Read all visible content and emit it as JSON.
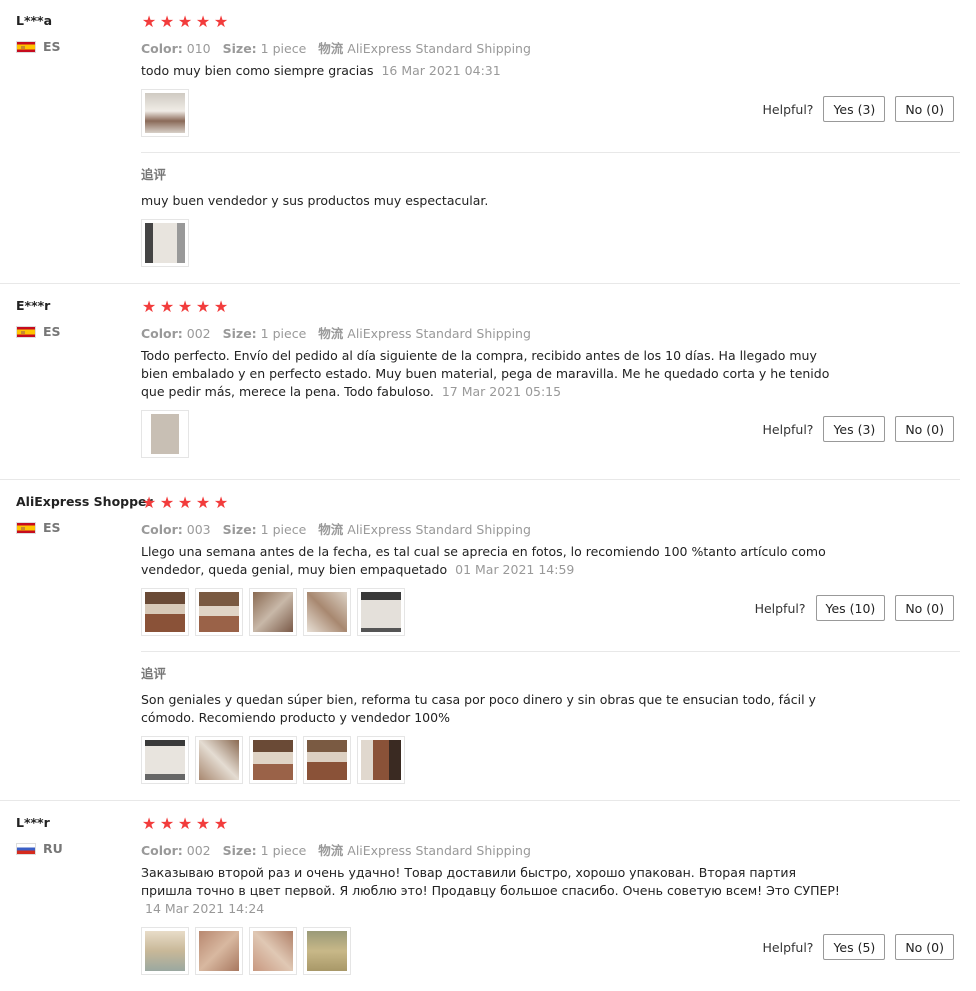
{
  "labels": {
    "color": "Color:",
    "size": "Size:",
    "shipping_key": "物流",
    "helpful": "Helpful?",
    "follow_up": "追评"
  },
  "reviews": [
    {
      "user": "L***a",
      "country": "ES",
      "color": "010",
      "size": "1 piece",
      "shipping": "AliExpress Standard Shipping",
      "text": "todo muy bien como siempre gracias",
      "date": "16 Mar 2021 04:31",
      "yes": "Yes (3)",
      "no": "No (0)",
      "followup": "muy buen vendedor y sus productos muy espectacular."
    },
    {
      "user": "E***r",
      "country": "ES",
      "color": "002",
      "size": "1 piece",
      "shipping": "AliExpress Standard Shipping",
      "text": "Todo perfecto. Envío del pedido al día siguiente de la compra, recibido antes de los 10 días. Ha llegado muy bien embalado y en perfecto estado. Muy buen material, pega de maravilla. Me he quedado corta y he tenido que pedir más, merece la pena. Todo fabuloso.",
      "date": "17 Mar 2021 05:15",
      "yes": "Yes (3)",
      "no": "No (0)"
    },
    {
      "user": "AliExpress Shopper",
      "country": "ES",
      "color": "003",
      "size": "1 piece",
      "shipping": "AliExpress Standard Shipping",
      "text": "Llego una semana antes de la fecha, es tal cual se aprecia en fotos, lo recomiendo 100 %tanto artículo como vendedor, queda genial, muy bien empaquetado",
      "date": "01 Mar 2021 14:59",
      "yes": "Yes (10)",
      "no": "No (0)",
      "followup": "Son geniales y quedan súper bien, reforma tu casa por poco dinero y sin obras que te ensucian todo, fácil y cómodo. Recomiendo producto y vendedor 100%"
    },
    {
      "user": "L***r",
      "country": "RU",
      "color": "002",
      "size": "1 piece",
      "shipping": "AliExpress Standard Shipping",
      "text": "Заказываю второй раз и очень удачно! Товар доставили быстро, хорошо упакован. Вторая партия пришла точно в цвет первой. Я люблю это! Продавцу большое спасибо. Очень советую всем! Это СУПЕР!",
      "date": "14 Mar 2021 14:24",
      "yes": "Yes (5)",
      "no": "No (0)"
    }
  ],
  "colors": {
    "star": "#f23c3c",
    "muted": "#999999",
    "divider": "#e8e8e8"
  }
}
